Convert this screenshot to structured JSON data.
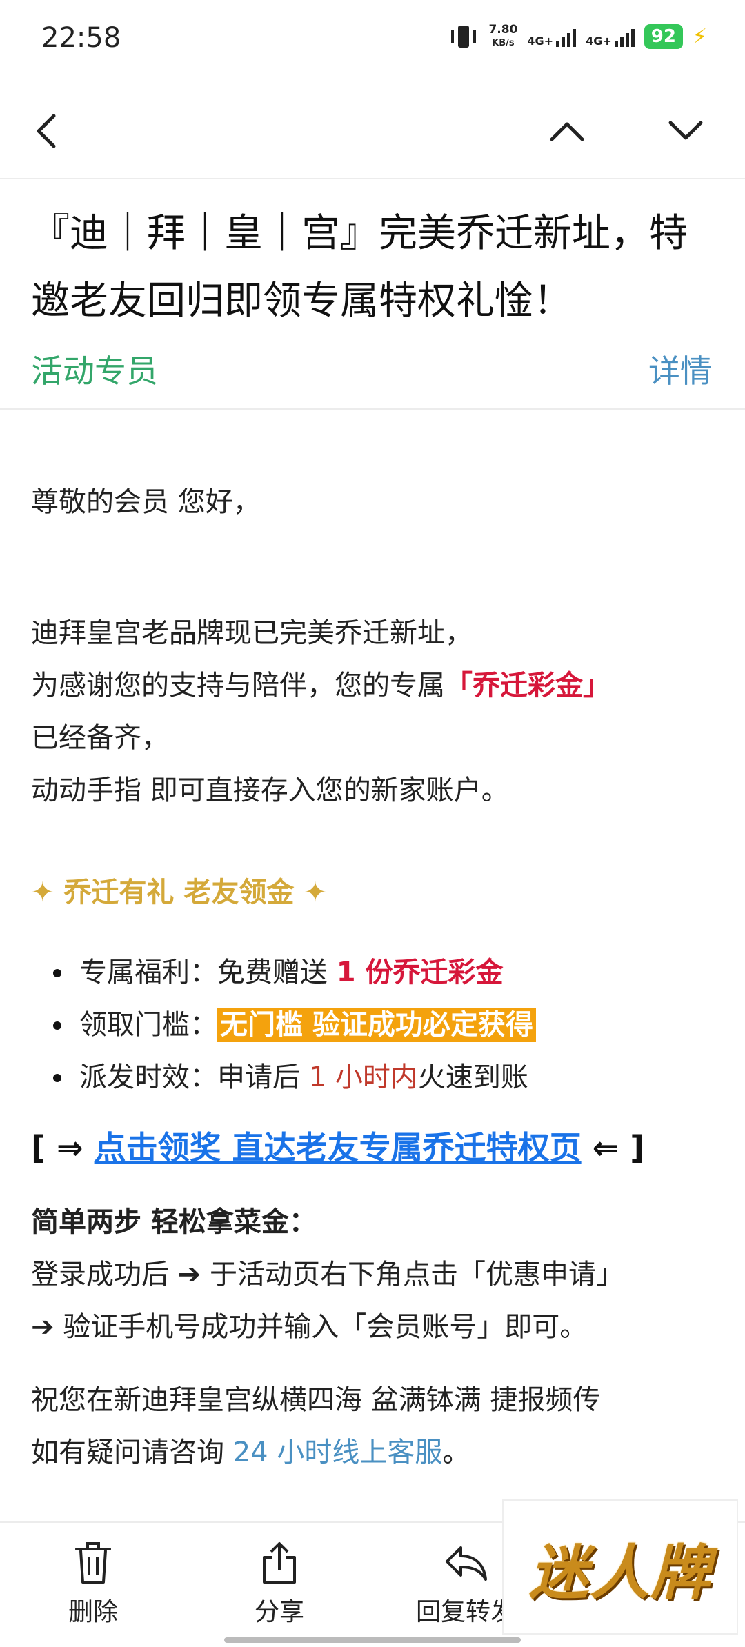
{
  "status": {
    "time": "22:58",
    "speed_value": "7.80",
    "speed_unit": "KB/s",
    "net1": "4G+",
    "net2": "4G+",
    "battery": "92"
  },
  "email": {
    "subject": "『迪｜拜｜皇｜宫』完美乔迁新址，特邀老友回归即领专属特权礼惍！",
    "sender": "活动专员",
    "details_label": "详情",
    "greeting": "尊敬的会员 您好，",
    "para1_line1": "迪拜皇宫老品牌现已完美乔迁新址，",
    "para1_line2_a": "为感谢您的支持与陪伴，您的专属",
    "para1_line2_b": "「乔迁彩金」",
    "para1_line3": "已经备齐，",
    "para1_line4": "动动手指 即可直接存入您的新家账户。",
    "section_title": "✦ 乔迁有礼 老友领金 ✦",
    "benefits": [
      {
        "label": "专属福利：",
        "pre": "免费赠送 ",
        "highlight": "1 份乔迁彩金",
        "post": ""
      },
      {
        "label": "领取门槛：",
        "pre": "",
        "highlight": "无门槛 验证成功必定获得",
        "post": ""
      },
      {
        "label": "派发时效：",
        "pre": "申请后 ",
        "highlight": "1 小时内",
        "post": "火速到账"
      }
    ],
    "cta_left": "[ ⇒ ",
    "cta_link": "点击领奖 直达老友专属乔迁特权页",
    "cta_right": " ⇐ ]",
    "steps_title": "简单两步 轻松拿菜金：",
    "step1": "登录成功后 ➔ 于活动页右下角点击「优惠申请」",
    "step2": "➔ 验证手机号成功并输入「会员账号」即可。",
    "closing": "祝您在新迪拜皇宫纵横四海 盆满钵满 捷报频传",
    "help_pre": "如有疑问请咨询 ",
    "help_link": "24 小时线上客服",
    "help_post": "。"
  },
  "toolbar": {
    "delete": "删除",
    "share": "分享",
    "reply": "回复转发"
  },
  "watermark": "迷人牌"
}
